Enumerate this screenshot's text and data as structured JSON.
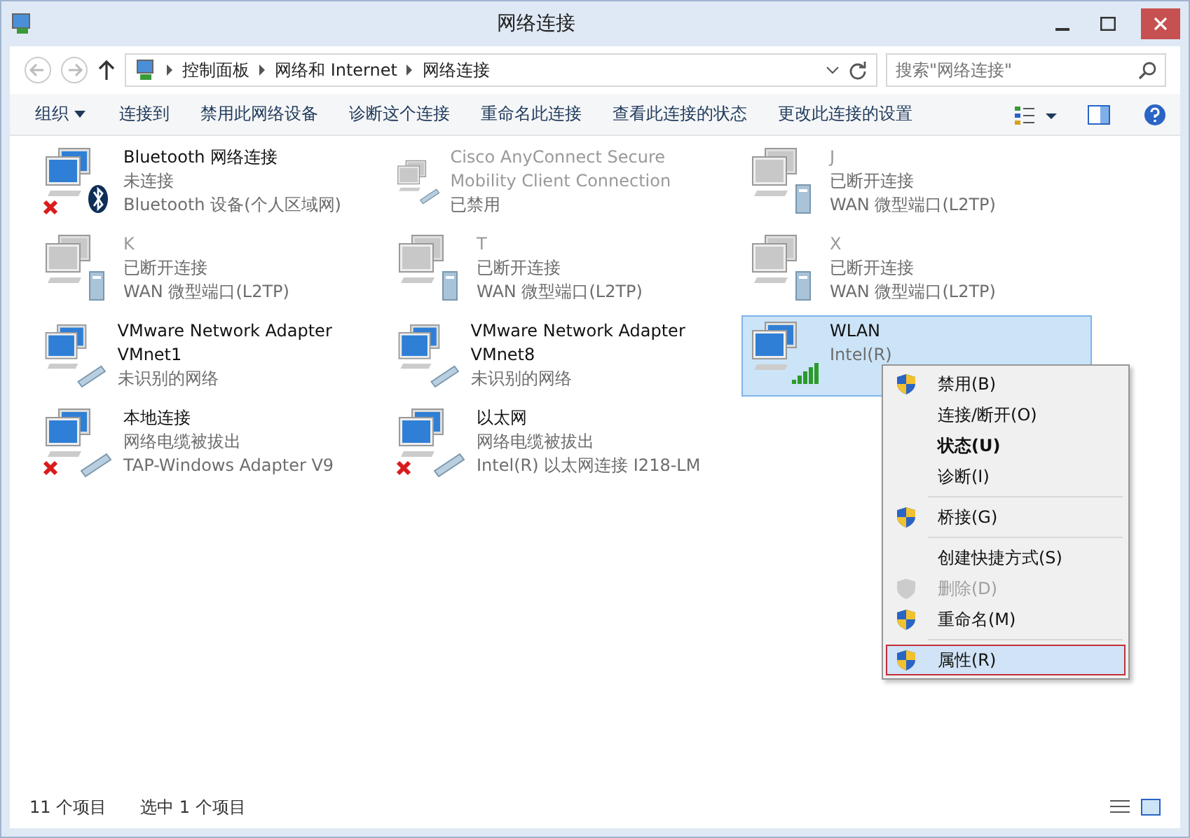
{
  "window": {
    "title": "网络连接"
  },
  "address": {
    "crumbs": [
      "控制面板",
      "网络和 Internet",
      "网络连接"
    ]
  },
  "search": {
    "placeholder": "搜索\"网络连接\""
  },
  "commands": [
    "组织",
    "连接到",
    "禁用此网络设备",
    "诊断这个连接",
    "重命名此连接",
    "查看此连接的状态",
    "更改此连接的设置"
  ],
  "connections": [
    {
      "name": "Bluetooth 网络连接",
      "status": "未连接",
      "device": "Bluetooth 设备(个人区域网)",
      "kind": "bluetooth",
      "error": true,
      "disabled": false,
      "selected": false
    },
    {
      "name": "Cisco AnyConnect Secure Mobility Client Connection",
      "status": "已禁用",
      "kind": "cable",
      "error": false,
      "disabled": true,
      "selected": false
    },
    {
      "name": "J",
      "status": "已断开连接",
      "device": "WAN 微型端口(L2TP)",
      "kind": "wan",
      "error": false,
      "disabled": true,
      "selected": false
    },
    {
      "name": "K",
      "status": "已断开连接",
      "device": "WAN 微型端口(L2TP)",
      "kind": "wan",
      "error": false,
      "disabled": true,
      "selected": false
    },
    {
      "name": "T",
      "status": "已断开连接",
      "device": "WAN 微型端口(L2TP)",
      "kind": "wan",
      "error": false,
      "disabled": true,
      "selected": false
    },
    {
      "name": "X",
      "status": "已断开连接",
      "device": "WAN 微型端口(L2TP)",
      "kind": "wan",
      "error": false,
      "disabled": true,
      "selected": false
    },
    {
      "name": "VMware Network Adapter VMnet1",
      "status": "未识别的网络",
      "kind": "cable",
      "error": false,
      "disabled": false,
      "selected": false
    },
    {
      "name": "VMware Network Adapter VMnet8",
      "status": "未识别的网络",
      "kind": "cable",
      "error": false,
      "disabled": false,
      "selected": false
    },
    {
      "name": "WLAN",
      "device": "Intel(R)",
      "kind": "wifi",
      "error": false,
      "disabled": false,
      "selected": true
    },
    {
      "name": "本地连接",
      "status": "网络电缆被拔出",
      "device": "TAP-Windows Adapter V9",
      "kind": "cable",
      "error": true,
      "disabled": false,
      "selected": false
    },
    {
      "name": "以太网",
      "status": "网络电缆被拔出",
      "device": "Intel(R) 以太网连接 I218-LM",
      "kind": "cable",
      "error": true,
      "disabled": false,
      "selected": false
    }
  ],
  "context_menu": [
    [
      {
        "label": "禁用(B)",
        "shield": true,
        "bold": false,
        "disabled": false,
        "selected": false
      },
      {
        "label": "连接/断开(O)",
        "shield": false,
        "bold": false,
        "disabled": false,
        "selected": false
      },
      {
        "label": "状态(U)",
        "shield": false,
        "bold": true,
        "disabled": false,
        "selected": false
      },
      {
        "label": "诊断(I)",
        "shield": false,
        "bold": false,
        "disabled": false,
        "selected": false
      }
    ],
    [
      {
        "label": "桥接(G)",
        "shield": true,
        "bold": false,
        "disabled": false,
        "selected": false
      }
    ],
    [
      {
        "label": "创建快捷方式(S)",
        "shield": false,
        "bold": false,
        "disabled": false,
        "selected": false
      },
      {
        "label": "删除(D)",
        "shield": true,
        "bold": false,
        "disabled": true,
        "selected": false
      },
      {
        "label": "重命名(M)",
        "shield": true,
        "bold": false,
        "disabled": false,
        "selected": false
      }
    ],
    [
      {
        "label": "属性(R)",
        "shield": true,
        "bold": false,
        "disabled": false,
        "selected": true
      }
    ]
  ],
  "status_bar": {
    "count": "11 个项目",
    "selection": "选中 1 个项目"
  }
}
